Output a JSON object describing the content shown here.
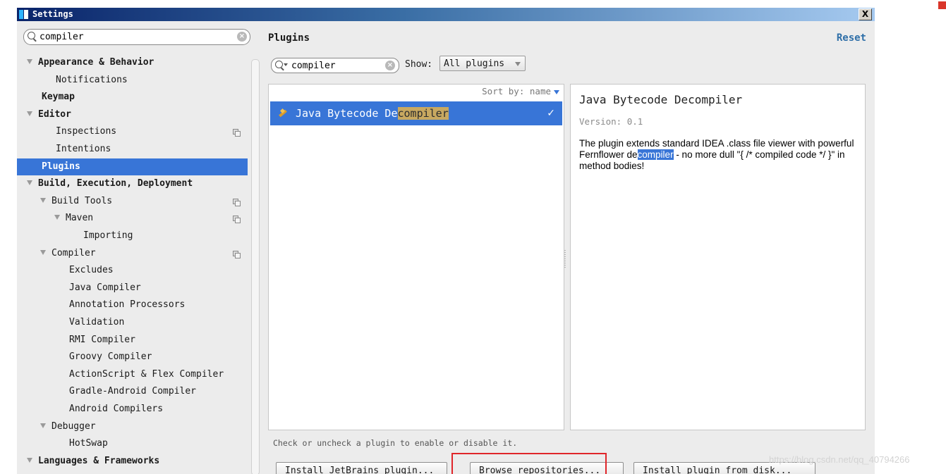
{
  "window": {
    "title": "Settings",
    "close_label": "X"
  },
  "left": {
    "search_value": "compiler",
    "tree": [
      {
        "label": "Appearance & Behavior",
        "bold": true,
        "arrow": true,
        "indent": 0,
        "copy": false
      },
      {
        "label": "Notifications",
        "bold": false,
        "arrow": false,
        "indent": 1,
        "copy": false
      },
      {
        "label": "Keymap",
        "bold": true,
        "arrow": false,
        "indent": 0,
        "copy": false
      },
      {
        "label": "Editor",
        "bold": true,
        "arrow": true,
        "indent": 0,
        "copy": false
      },
      {
        "label": "Inspections",
        "bold": false,
        "arrow": false,
        "indent": 1,
        "copy": true
      },
      {
        "label": "Intentions",
        "bold": false,
        "arrow": false,
        "indent": 1,
        "copy": false
      },
      {
        "label": "Plugins",
        "bold": true,
        "arrow": false,
        "indent": 0,
        "copy": false,
        "selected": true
      },
      {
        "label": "Build, Execution, Deployment",
        "bold": true,
        "arrow": true,
        "indent": 0,
        "copy": false
      },
      {
        "label": "Build Tools",
        "bold": false,
        "arrow": true,
        "indent": 1,
        "copy": true
      },
      {
        "label": "Maven",
        "bold": false,
        "arrow": true,
        "indent": 2,
        "copy": true
      },
      {
        "label": "Importing",
        "bold": false,
        "arrow": false,
        "indent": 3,
        "copy": false
      },
      {
        "label": "Compiler",
        "bold": false,
        "arrow": true,
        "indent": 1,
        "copy": true
      },
      {
        "label": "Excludes",
        "bold": false,
        "arrow": false,
        "indent": 2,
        "copy": false
      },
      {
        "label": "Java Compiler",
        "bold": false,
        "arrow": false,
        "indent": 2,
        "copy": false
      },
      {
        "label": "Annotation Processors",
        "bold": false,
        "arrow": false,
        "indent": 2,
        "copy": false
      },
      {
        "label": "Validation",
        "bold": false,
        "arrow": false,
        "indent": 2,
        "copy": false
      },
      {
        "label": "RMI Compiler",
        "bold": false,
        "arrow": false,
        "indent": 2,
        "copy": false
      },
      {
        "label": "Groovy Compiler",
        "bold": false,
        "arrow": false,
        "indent": 2,
        "copy": false
      },
      {
        "label": "ActionScript & Flex Compiler",
        "bold": false,
        "arrow": false,
        "indent": 2,
        "copy": false
      },
      {
        "label": "Gradle-Android Compiler",
        "bold": false,
        "arrow": false,
        "indent": 2,
        "copy": false
      },
      {
        "label": "Android Compilers",
        "bold": false,
        "arrow": false,
        "indent": 2,
        "copy": false
      },
      {
        "label": "Debugger",
        "bold": false,
        "arrow": true,
        "indent": 1,
        "copy": false
      },
      {
        "label": "HotSwap",
        "bold": false,
        "arrow": false,
        "indent": 2,
        "copy": false
      },
      {
        "label": "Languages & Frameworks",
        "bold": true,
        "arrow": true,
        "indent": 0,
        "copy": false
      }
    ]
  },
  "right": {
    "title": "Plugins",
    "reset_label": "Reset",
    "search_value": "compiler",
    "show_label": "Show:",
    "show_selected": "All plugins",
    "sort_label": "Sort by: name",
    "plugin_name_pre": "Java Bytecode De",
    "plugin_name_match": "compiler",
    "detail": {
      "title": "Java Bytecode Decompiler",
      "version": "Version: 0.1",
      "desc_pre": "The plugin extends standard IDEA .class file viewer with powerful Fernflower de",
      "desc_match": "compiler",
      "desc_post": " - no more dull \"{ /* compiled code */ }\" in method bodies!"
    },
    "hint": "Check or uncheck a plugin to enable or disable it.",
    "buttons": {
      "install_jetbrains": "Install JetBrains plugin...",
      "browse": "Browse repositories...",
      "install_disk": "Install plugin from disk..."
    }
  },
  "watermark": "https://blog.csdn.net/qq_40794266"
}
